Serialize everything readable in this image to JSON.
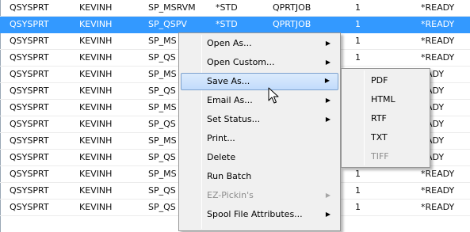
{
  "rows": [
    {
      "cells": [
        "QSYSPRT",
        "KEVINH",
        "SP_MSRVM",
        "*STD",
        "QPRTJOB",
        "1",
        "*READY"
      ],
      "selected": false
    },
    {
      "cells": [
        "QSYSPRT",
        "KEVINH",
        "SP_QSPV",
        "*STD",
        "QPRTJOB",
        "1",
        "*READY"
      ],
      "selected": true
    },
    {
      "cells": [
        "QSYSPRT",
        "KEVINH",
        "SP_MS",
        "",
        "",
        "1",
        "*READY"
      ],
      "selected": false
    },
    {
      "cells": [
        "QSYSPRT",
        "KEVINH",
        "SP_QS",
        "",
        "",
        "1",
        "*READY"
      ],
      "selected": false
    },
    {
      "cells": [
        "QSYSPRT",
        "KEVINH",
        "SP_MS",
        "",
        "",
        "",
        "EADY"
      ],
      "selected": false
    },
    {
      "cells": [
        "QSYSPRT",
        "KEVINH",
        "SP_QS",
        "",
        "",
        "",
        "EADY"
      ],
      "selected": false
    },
    {
      "cells": [
        "QSYSPRT",
        "KEVINH",
        "SP_MS",
        "",
        "",
        "",
        "EADY"
      ],
      "selected": false
    },
    {
      "cells": [
        "QSYSPRT",
        "KEVINH",
        "SP_QS",
        "",
        "",
        "",
        "EADY"
      ],
      "selected": false
    },
    {
      "cells": [
        "QSYSPRT",
        "KEVINH",
        "SP_MS",
        "",
        "",
        "",
        "EADY"
      ],
      "selected": false
    },
    {
      "cells": [
        "QSYSPRT",
        "KEVINH",
        "SP_QS",
        "",
        "",
        "",
        "EADY"
      ],
      "selected": false
    },
    {
      "cells": [
        "QSYSPRT",
        "KEVINH",
        "SP_MS",
        "",
        "",
        "1",
        "*READY"
      ],
      "selected": false
    },
    {
      "cells": [
        "QSYSPRT",
        "KEVINH",
        "SP_QS",
        "",
        "",
        "1",
        "*READY"
      ],
      "selected": false
    },
    {
      "cells": [
        "QSYSPRT",
        "KEVINH",
        "SP_QS",
        "",
        "",
        "1",
        "*READY"
      ],
      "selected": false
    }
  ],
  "context_menu": {
    "items": [
      {
        "label": "Open As...",
        "submenu": true,
        "disabled": false,
        "highlighted": false
      },
      {
        "label": "Open Custom...",
        "submenu": true,
        "disabled": false,
        "highlighted": false
      },
      {
        "label": "Save As...",
        "submenu": true,
        "disabled": false,
        "highlighted": true
      },
      {
        "label": "Email As...",
        "submenu": true,
        "disabled": false,
        "highlighted": false
      },
      {
        "label": "Set Status...",
        "submenu": true,
        "disabled": false,
        "highlighted": false
      },
      {
        "label": "Print...",
        "submenu": false,
        "disabled": false,
        "highlighted": false
      },
      {
        "label": "Delete",
        "submenu": false,
        "disabled": false,
        "highlighted": false
      },
      {
        "label": "Run Batch",
        "submenu": false,
        "disabled": false,
        "highlighted": false
      },
      {
        "label": "EZ-Pickin's",
        "submenu": true,
        "disabled": true,
        "highlighted": false
      },
      {
        "label": "Spool File Attributes...",
        "submenu": true,
        "disabled": false,
        "highlighted": false
      }
    ],
    "submenu_arrow": "▶"
  },
  "save_as_submenu": {
    "items": [
      {
        "label": "PDF",
        "disabled": false
      },
      {
        "label": "HTML",
        "disabled": false
      },
      {
        "label": "RTF",
        "disabled": false
      },
      {
        "label": "TXT",
        "disabled": false
      },
      {
        "label": "TIFF",
        "disabled": true
      }
    ]
  },
  "colors": {
    "selection": "#3399ff",
    "menu_background": "#f0f0f0",
    "menu_highlight": "#c1dbfc",
    "disabled_text": "#8d8d8d"
  },
  "cursor": {
    "icon": "arrow-pointer-icon"
  }
}
